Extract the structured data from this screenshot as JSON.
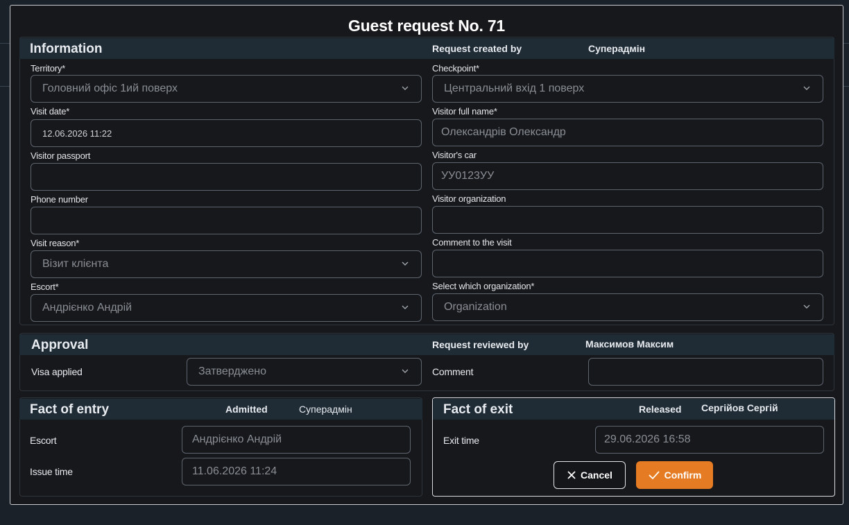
{
  "modal": {
    "title": "Guest request No. 71"
  },
  "information": {
    "title": "Information",
    "created_by_label": "Request created by",
    "created_by_value": "Суперадмін",
    "territory": {
      "label": "Territory*",
      "value": "Головний офіс 1ий поверх"
    },
    "checkpoint": {
      "label": "Checkpoint*",
      "value": "Центральний вхід 1 поверх"
    },
    "visit_date": {
      "label": "Visit date*",
      "value": "12.06.2026 11:22"
    },
    "visitor_full_name": {
      "label": "Visitor full name*",
      "value": "Олександрів Олександр"
    },
    "visitor_passport": {
      "label": "Visitor passport",
      "value": ""
    },
    "visitor_car": {
      "label": "Visitor's car",
      "value": "УУ0123УУ"
    },
    "phone_number": {
      "label": "Phone number",
      "value": ""
    },
    "visitor_organization": {
      "label": "Visitor organization",
      "value": ""
    },
    "visit_reason": {
      "label": "Visit reason*",
      "value": "Візит клієнта"
    },
    "comment_visit": {
      "label": "Comment to the visit",
      "value": ""
    },
    "escort": {
      "label": "Escort*",
      "value": "Андрієнко Андрій"
    },
    "select_org": {
      "label": "Select which organization*",
      "value": "Organization"
    }
  },
  "approval": {
    "title": "Approval",
    "reviewed_by_label": "Request reviewed by",
    "reviewed_by_value": "Максимов Максим",
    "visa_label": "Visa applied",
    "visa_value": "Затверджено",
    "comment_label": "Comment",
    "comment_value": ""
  },
  "entry": {
    "title": "Fact of entry",
    "admitted_label": "Admitted",
    "admitted_value": "Суперадмін",
    "escort_label": "Escort",
    "escort_value": "Андрієнко Андрій",
    "issue_label": "Issue time",
    "issue_value": "11.06.2026 11:24"
  },
  "exit": {
    "title": "Fact of exit",
    "released_label": "Released",
    "released_value": "Сергійов Сергій",
    "exit_label": "Exit time",
    "exit_value": "29.06.2026 16:58"
  },
  "buttons": {
    "cancel": "Cancel",
    "confirm": "Confirm"
  },
  "colors": {
    "accent": "#e57c23",
    "section_bar": "#1f2b35",
    "background": "#17181c"
  }
}
